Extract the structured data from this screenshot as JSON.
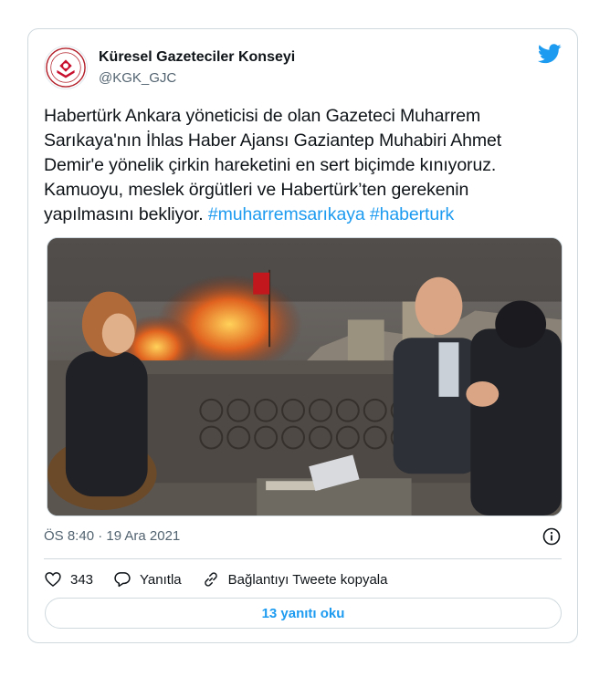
{
  "author": {
    "name": "Küresel Gazeteciler Konseyi",
    "handle": "@KGK_GJC"
  },
  "tweet": {
    "text_lines": [
      "Habertürk Ankara yöneticisi de olan Gazeteci Muharrem",
      "Sarıkaya'nın İhlas Haber Ajansı Gaziantep Muhabiri Ahmet",
      "Demir'e yönelik çirkin hareketini en sert biçimde kınıyoruz.",
      "Kamuoyu, meslek örgütleri ve Habertürk’ten gerekenin"
    ],
    "last_line_text": "yapılmasını bekliyor. ",
    "hashtags": [
      "#muharremsarıkaya",
      "#haberturk"
    ]
  },
  "meta": {
    "timestamp": "ÖS 8:40 · 19 Ara 2021"
  },
  "actions": {
    "like_count": "343",
    "reply_label": "Yanıtla",
    "copy_link_label": "Bağlantıyı Tweete kopyala"
  },
  "read_replies_label": "13 yanıtı oku",
  "icons": {
    "brand": "twitter-bird-icon",
    "info": "info-icon",
    "like": "heart-icon",
    "reply": "speech-bubble-icon",
    "link": "link-icon"
  },
  "colors": {
    "accent": "#1d9bf0",
    "text": "#0f1419",
    "secondary": "#536471",
    "border": "#cfd9de"
  }
}
